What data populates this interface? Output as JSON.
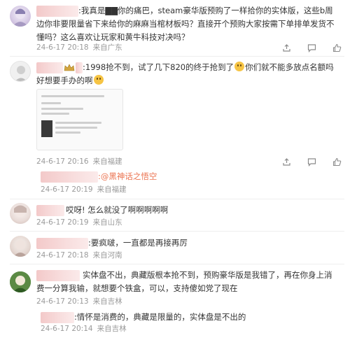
{
  "comments": [
    {
      "text": ":我真是▇▇你的痛巴，steam豪华版预购了一样拾你的实体版，这些b周边你非要限量省下来给你的麻麻当棺材板吗？直接开个预购大家按需下单排单发货不懂吗？这么喜欢让玩家和黄牛科技对决吗？",
      "date": "24-6-17 20:18",
      "location": "来自广东"
    },
    {
      "text_before": ":1998抢不到，试了几下820的终于抢到了",
      "text_after": "你们就不能多放点名额吗 好想要手办的啊",
      "date": "24-6-17 20:16",
      "location": "来自福建",
      "reply": {
        "mention": ":@黑神话之悟空",
        "date": "24-6-17 20:19",
        "location": "来自福建"
      }
    },
    {
      "text": "哎呀! 怎么就没了啊啊啊啊啊",
      "date": "24-6-17 20:19",
      "location": "来自山东"
    },
    {
      "text": ":要疯啵，一直都是再接再厉",
      "date": "24-6-17 20:18",
      "location": "来自河南"
    },
    {
      "text": "实体盘不出，典藏版根本抢不到，预购豪华版是我错了，再在你身上消费一分算我输，就想要个铁盒，可以，支持傻如党了现在",
      "date": "24-6-17 20:13",
      "location": "来自吉林",
      "reply": {
        "text": ":情怀是消费的，典藏是限量的，实体盘是不出的",
        "date": "24-6-17 20:14",
        "location": "来自吉林"
      }
    }
  ],
  "colors": {
    "accent": "#eb7350",
    "meta": "#9a9a9a",
    "text": "#333333"
  },
  "icons": [
    "share-icon",
    "comment-icon",
    "like-icon"
  ]
}
